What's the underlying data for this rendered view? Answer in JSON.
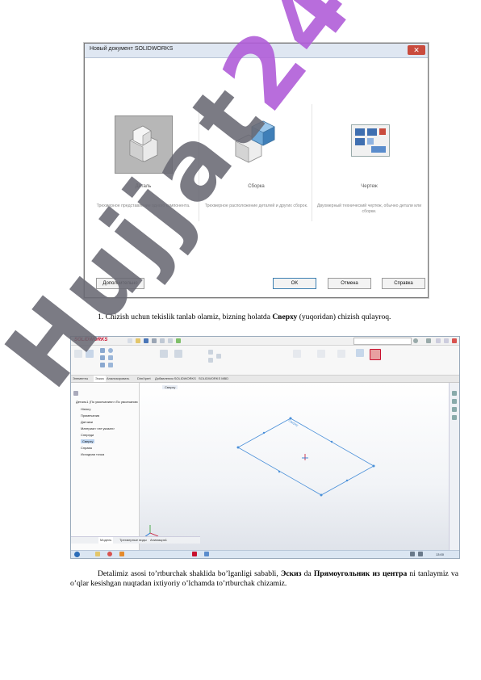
{
  "dialog": {
    "title": "Новый документ SOLIDWORKS",
    "cards": [
      {
        "label": "Деталь",
        "desc": "Трехмерное представление одного компонента."
      },
      {
        "label": "Сборка",
        "desc": "Трехмерное расположение деталей и других сборок."
      },
      {
        "label": "Чертеж",
        "desc": "Двухмерный технический чертеж, обычно детали или сборки."
      }
    ],
    "buttons": {
      "advanced": "Дополнительно",
      "ok": "OK",
      "cancel": "Отмена",
      "help": "Справка"
    }
  },
  "paragraphs": {
    "p1_a": "1. Chizish uchun tekislik tanlab olamiz, bizning holatda ",
    "p1_b": "Сверху",
    "p1_c": " (yuqoridan) chizish qulayroq.",
    "p2_a": "Detalimiz asosi to’rtburchak shaklida bo’lganligi sababli, ",
    "p2_b": "Эскиз",
    "p2_c": " da ",
    "p2_d": "Прямоугольник из центра",
    "p2_e": " ni tanlaymiz va o’qlar kesishgan nuqtadan ixtiyoriy o’lchamda to’rtburchak chizamiz."
  },
  "sw": {
    "logo": "SOLIDWORKS",
    "tabs": [
      "Элементы",
      "Эскиз",
      "Анализировать",
      "DimXpert",
      "Добавления SOLIDWORKS",
      "SOLIDWORKS MBD"
    ],
    "tree": [
      "Деталь1 (По умолчанию<<По умолчанию",
      "History",
      "Примечания",
      "Датчики",
      "Материал <не указан>",
      "Спереди",
      "Сверху",
      "Справа",
      "Исходная точка"
    ],
    "bottom_tabs": [
      "Модель",
      "Трехмерные виды",
      "Анимация1"
    ],
    "view_label": "Сверху",
    "plane_label": "Сверху",
    "time": "13:00"
  },
  "watermark": {
    "hi": "Hujjat",
    "lo": "24"
  },
  "colors": {
    "ribbon_accent": "#c8102e",
    "plane": "#4a90d9",
    "watermark_purple": "#b05dd8"
  }
}
